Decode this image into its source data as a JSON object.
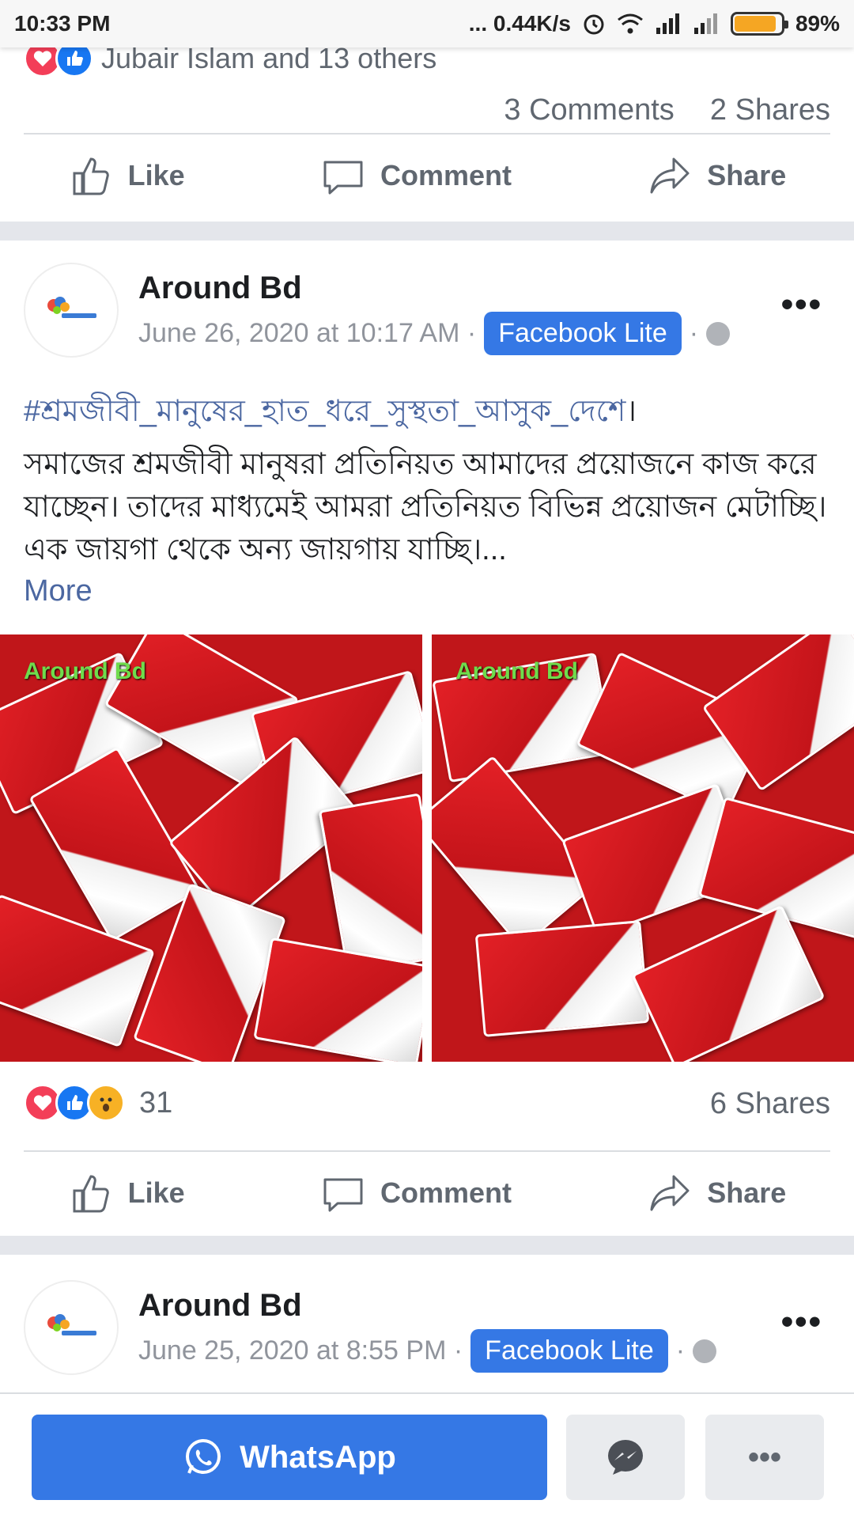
{
  "status_bar": {
    "time": "10:33 PM",
    "network_speed": "... 0.44K/s",
    "battery": "89%",
    "battery_level": 0.89
  },
  "prev_post": {
    "reactors_text": "Jubair Islam and 13 others",
    "comments": "3 Comments",
    "shares": "2 Shares"
  },
  "actions": {
    "like": "Like",
    "comment": "Comment",
    "share": "Share"
  },
  "post": {
    "page_name": "Around Bd",
    "timestamp": "June 26, 2020 at 10:17 AM ·",
    "app_badge": "Facebook Lite",
    "dot": "·",
    "hashtag": "#শ্রমজীবী_মানুষের_হাত_ধরে_সুস্থতা_আসুক_দেশে",
    "hashtag_end": "।",
    "body": "সমাজের শ্রমজীবী মানুষরা প্রতিনিয়ত আমাদের প্রয়োজনে কাজ করে যাচ্ছেন। তাদের মাধ্যমেই আমরা প্রতিনিয়ত বিভিন্ন প্রয়োজন মেটাচ্ছি। এক জায়গা থেকে অন্য জায়গায় যাচ্ছি।...",
    "more": "More",
    "watermark": "Around Bd",
    "reaction_count": "31",
    "shares": "6 Shares"
  },
  "next_post": {
    "page_name": "Around Bd",
    "timestamp": "June 25, 2020 at 8:55 PM ·",
    "app_badge": "Facebook Lite",
    "dot": "·"
  },
  "bottom_bar": {
    "whatsapp": "WhatsApp",
    "overflow": "•••"
  },
  "colors": {
    "brand_blue": "#3578e5",
    "link_blue": "#4b67a1",
    "love_red": "#f33e58",
    "wow_yellow": "#f7b125"
  }
}
